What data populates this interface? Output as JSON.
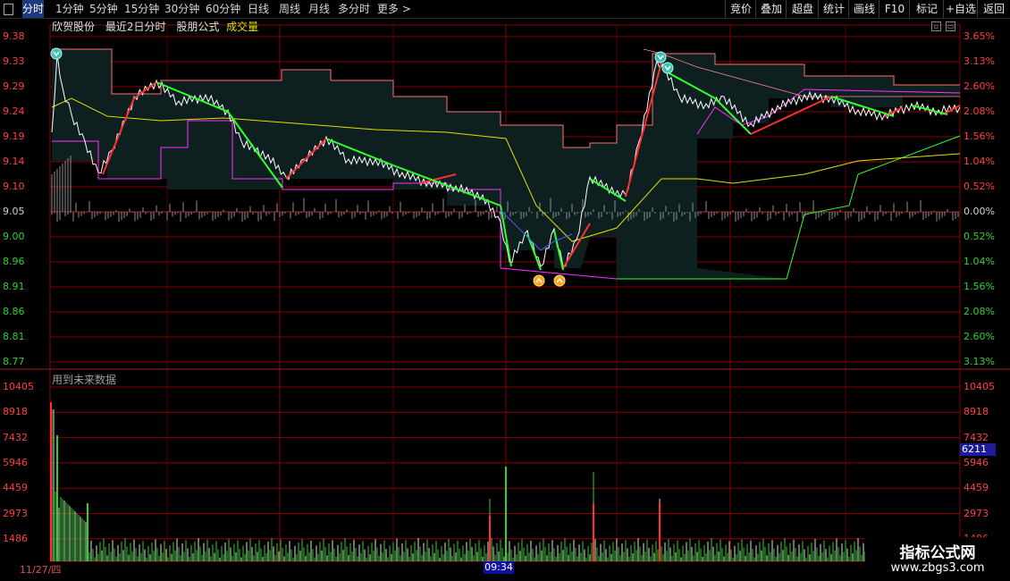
{
  "toolbar": {
    "timeframes": [
      "分时",
      "1分钟",
      "5分钟",
      "15分钟",
      "30分钟",
      "60分钟",
      "日线",
      "周线",
      "月线",
      "多分时",
      "更多 >"
    ],
    "right_buttons": [
      "竞价",
      "叠加",
      "超盘",
      "统计",
      "画线",
      "F10",
      "标记",
      "+自选",
      "返回"
    ]
  },
  "info": {
    "stock_name": "欣贺股份",
    "period_label": "最近2日分时",
    "formula_name": "股朋公式",
    "indicator_name": "成交量"
  },
  "price_axis": {
    "left": [
      "9.38",
      "9.33",
      "9.29",
      "9.24",
      "9.19",
      "9.14",
      "9.10",
      "9.05",
      "9.00",
      "8.96",
      "8.91",
      "8.86",
      "8.81",
      "8.77"
    ],
    "right": [
      "3.65%",
      "3.13%",
      "2.60%",
      "2.08%",
      "1.56%",
      "1.04%",
      "0.52%",
      "0.00%",
      "0.52%",
      "1.04%",
      "1.56%",
      "2.08%",
      "2.60%",
      "3.13%"
    ]
  },
  "volume_axis": {
    "left": [
      "10405",
      "8918",
      "7432",
      "5946",
      "4459",
      "2973",
      "1486"
    ],
    "right": [
      "10405",
      "8918",
      "7432",
      "5946",
      "4459",
      "2973",
      "1486"
    ]
  },
  "volume_current": "6211",
  "future_data_note": "用到未来数据",
  "footer": {
    "date": "11/27/四",
    "time": "09:34"
  },
  "watermark": {
    "title": "指标公式网",
    "url": "www.zbgs3.com"
  },
  "colors": {
    "grid": "#8a0000",
    "up": "#ff3030",
    "down": "#30ff30",
    "price_line": "#ffffff",
    "avg_line": "#e0e000",
    "band_fill": "#0e1f1f",
    "band_upper": "#ff7070",
    "band_lower": "#ff30ff"
  }
}
